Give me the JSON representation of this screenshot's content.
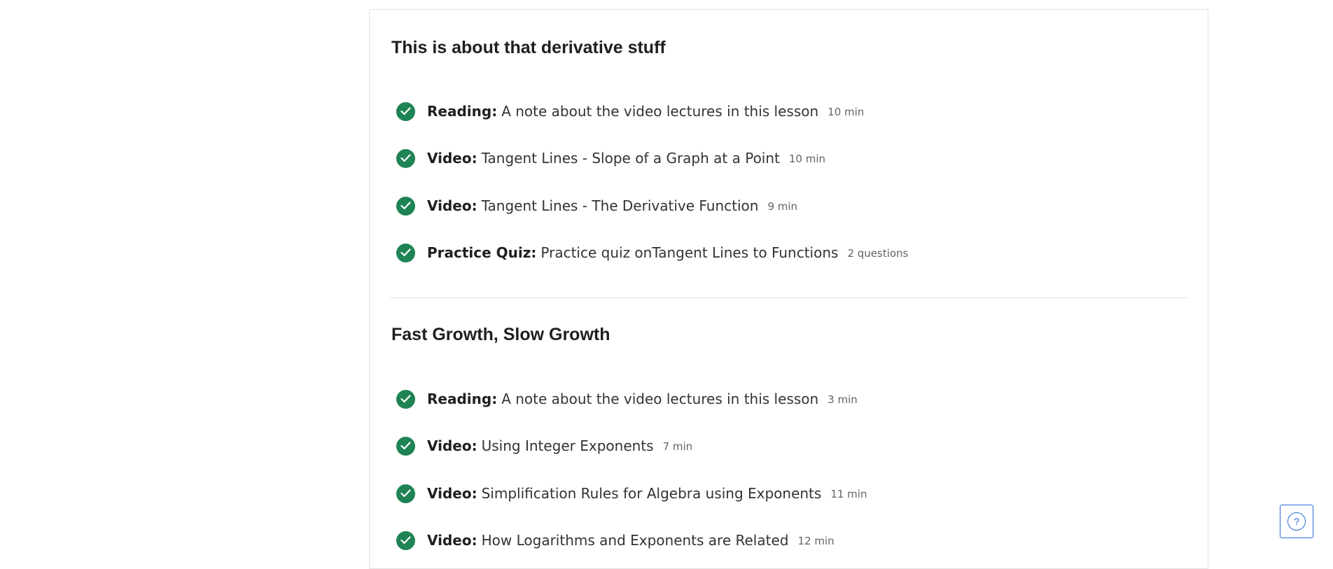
{
  "sections": [
    {
      "title": "This is about that derivative stuff",
      "items": [
        {
          "type": "Reading:",
          "title": "A note about the video lectures in this lesson",
          "meta": "10 min"
        },
        {
          "type": "Video:",
          "title": "Tangent Lines - Slope of a Graph at a Point",
          "meta": "10 min"
        },
        {
          "type": "Video:",
          "title": "Tangent Lines - The Derivative Function",
          "meta": "9 min"
        },
        {
          "type": "Practice Quiz:",
          "title": "Practice quiz onTangent Lines to Functions",
          "meta": "2 questions"
        }
      ]
    },
    {
      "title": "Fast Growth, Slow Growth",
      "items": [
        {
          "type": "Reading:",
          "title": "A note about the video lectures in this lesson",
          "meta": "3 min"
        },
        {
          "type": "Video:",
          "title": "Using Integer Exponents",
          "meta": "7 min"
        },
        {
          "type": "Video:",
          "title": "Simplification Rules for Algebra using Exponents",
          "meta": "11 min"
        },
        {
          "type": "Video:",
          "title": "How Logarithms and Exponents are Related",
          "meta": "12 min"
        }
      ]
    }
  ],
  "help": {
    "label": "?"
  },
  "icons": {
    "completed": "check-circle-icon",
    "help": "question-circle-icon"
  },
  "colors": {
    "completed": "#1f8354",
    "help": "#2b6bd6"
  }
}
